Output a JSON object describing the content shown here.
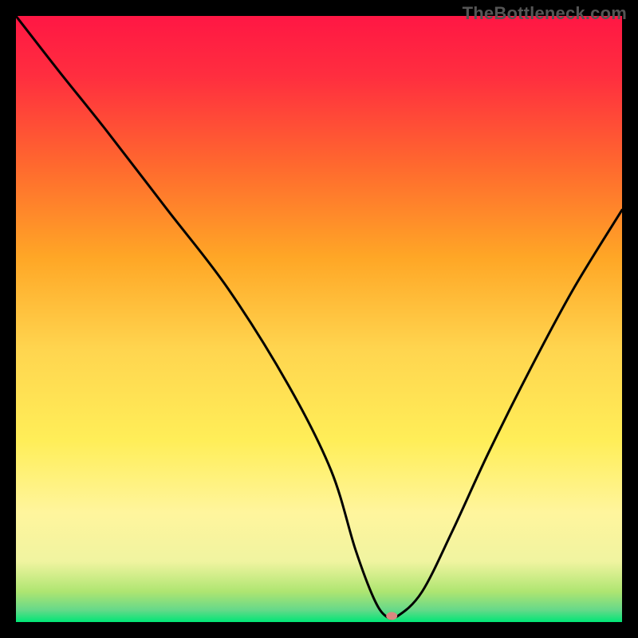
{
  "watermark": "TheBottleneck.com",
  "chart_data": {
    "type": "line",
    "title": "",
    "xlabel": "",
    "ylabel": "",
    "xlim": [
      0,
      100
    ],
    "ylim": [
      0,
      100
    ],
    "grid": false,
    "legend": false,
    "gradient_stops": [
      {
        "offset": 0,
        "color": "#ff1744"
      },
      {
        "offset": 10,
        "color": "#ff2e3f"
      },
      {
        "offset": 25,
        "color": "#ff6a2e"
      },
      {
        "offset": 40,
        "color": "#ffa726"
      },
      {
        "offset": 55,
        "color": "#ffd54f"
      },
      {
        "offset": 70,
        "color": "#ffee58"
      },
      {
        "offset": 82,
        "color": "#fff59d"
      },
      {
        "offset": 90,
        "color": "#f0f4a0"
      },
      {
        "offset": 95,
        "color": "#aee571"
      },
      {
        "offset": 98,
        "color": "#66d989"
      },
      {
        "offset": 100,
        "color": "#00e676"
      }
    ],
    "series": [
      {
        "name": "bottleneck-curve",
        "color": "#000000",
        "x": [
          0,
          7,
          15,
          25,
          35,
          45,
          52,
          56,
          59,
          61,
          63,
          67,
          72,
          78,
          85,
          92,
          100
        ],
        "values": [
          100,
          91,
          81,
          68,
          55,
          39,
          25,
          12,
          4,
          1,
          1,
          5,
          15,
          28,
          42,
          55,
          68
        ]
      }
    ],
    "marker": {
      "name": "optimal-point",
      "x": 62,
      "y": 1,
      "color": "#d98880",
      "rx": 7,
      "ry": 5
    }
  }
}
